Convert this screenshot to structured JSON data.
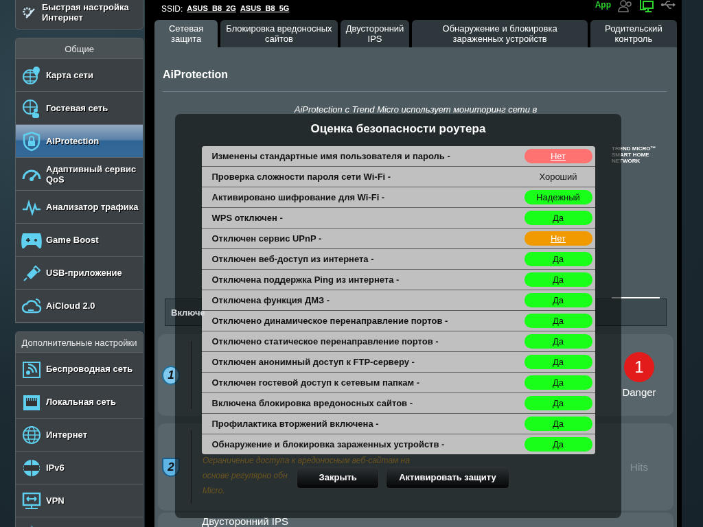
{
  "header": {
    "ssid_label": "SSID:",
    "ssids": [
      "ASUS_B8_2G",
      "ASUS_B8_5G"
    ],
    "app_label": "App"
  },
  "sidebar": {
    "quick_setup": "Быстрая настройка Интернет",
    "groups": [
      {
        "title": "Общие",
        "items": [
          {
            "label": "Карта сети",
            "selected": false
          },
          {
            "label": "Гостевая сеть",
            "selected": false
          },
          {
            "label": "AiProtection",
            "selected": true
          },
          {
            "label": "Адаптивный сервис QoS",
            "selected": false
          },
          {
            "label": "Анализатор трафика",
            "selected": false
          },
          {
            "label": "Game Boost",
            "selected": false
          },
          {
            "label": "USB-приложение",
            "selected": false
          },
          {
            "label": "AiCloud 2.0",
            "selected": false
          }
        ]
      },
      {
        "title": "Дополнительные настройки",
        "items": [
          {
            "label": "Беспроводная сеть",
            "selected": false
          },
          {
            "label": "Локальная сеть",
            "selected": false
          },
          {
            "label": "Интернет",
            "selected": false
          },
          {
            "label": "IPv6",
            "selected": false
          },
          {
            "label": "VPN",
            "selected": false
          },
          {
            "selected": false
          }
        ]
      }
    ]
  },
  "tabs": [
    {
      "label": "Сетевая защита",
      "selected": true
    },
    {
      "label": "Блокировка вредоносных сайтов",
      "selected": false
    },
    {
      "label": "Двусторонний IPS",
      "selected": false
    },
    {
      "label": "Обнаружение и блокировка зараженных устройств",
      "selected": false
    },
    {
      "label": "Родительский контроль",
      "selected": false
    }
  ],
  "panel": {
    "title": "AiProtection",
    "intro": "AiProtection с Trend Micro использует мониторинг сети в",
    "logo": "TREND MICRO™ SMART HOME NETWORK",
    "enable_bar": "Включе",
    "sections": [
      {
        "number": "1",
        "count": "1",
        "count_label": "Danger"
      },
      {
        "number": "2",
        "description_lines": [
          "Ограничение доступа к вредоносным веб-сайтам на",
          "основе регулярно обн",
          "Micro."
        ],
        "count_label": "Hits"
      },
      {
        "title": "Двусторонний IPS"
      }
    ]
  },
  "modal": {
    "title": "Оценка безопасности роутера",
    "rows": [
      {
        "label": "Изменены стандартные имя пользователя и пароль -",
        "result": "Нет",
        "kind": "bad"
      },
      {
        "label": "Проверка сложности пароля сети Wi-Fi -",
        "result": "Хороший",
        "kind": "plain"
      },
      {
        "label": "Активировано шифрование для Wi-Fi -",
        "result": "Надежный",
        "kind": "good"
      },
      {
        "label": "WPS отключен -",
        "result": "Да",
        "kind": "good"
      },
      {
        "label": "Отключен сервис UPnP -",
        "result": "Нет",
        "kind": "warning"
      },
      {
        "label": "Отключен веб-доступ из интернета -",
        "result": "Да",
        "kind": "good"
      },
      {
        "label": "Отключена поддержка Ping из интернета -",
        "result": "Да",
        "kind": "good"
      },
      {
        "label": "Отключена функция ДМЗ -",
        "result": "Да",
        "kind": "good"
      },
      {
        "label": "Отключено динамическое перенаправление портов -",
        "result": "Да",
        "kind": "good"
      },
      {
        "label": "Отключено статическое перенаправление портов -",
        "result": "Да",
        "kind": "good"
      },
      {
        "label": "Отключен анонимный доступ к FTP-серверу -",
        "result": "Да",
        "kind": "good"
      },
      {
        "label": "Отключен гостевой доступ к сетевым папкам -",
        "result": "Да",
        "kind": "good"
      },
      {
        "label": "Включена блокировка вредоносных сайтов -",
        "result": "Да",
        "kind": "good"
      },
      {
        "label": "Профилактика вторжений включена -",
        "result": "Да",
        "kind": "good"
      },
      {
        "label": "Обнаружение и блокировка зараженных устройств -",
        "result": "Да",
        "kind": "good"
      }
    ],
    "buttons": [
      "Закрыть",
      "Активировать защиту"
    ]
  }
}
